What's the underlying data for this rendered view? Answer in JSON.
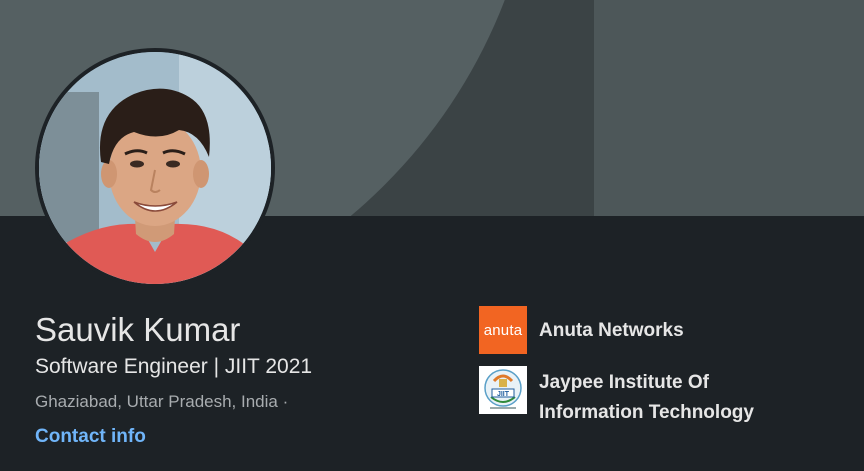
{
  "profile": {
    "name": "Sauvik Kumar",
    "headline": "Software Engineer | JIIT 2021",
    "location": "Ghaziabad, Uttar Pradesh, India ·",
    "contact_label": "Contact info"
  },
  "organizations": [
    {
      "name": "Anuta Networks",
      "logo_text": "anuta",
      "logo_color": "#f26522"
    },
    {
      "name": "Jaypee Institute Of Information Technology",
      "logo_text": "JIIT"
    }
  ],
  "colors": {
    "background": "#1d2226",
    "banner": "#3b4345",
    "text_primary": "#e6e6e6",
    "text_secondary": "#a8acaf",
    "link": "#70b5f9"
  }
}
